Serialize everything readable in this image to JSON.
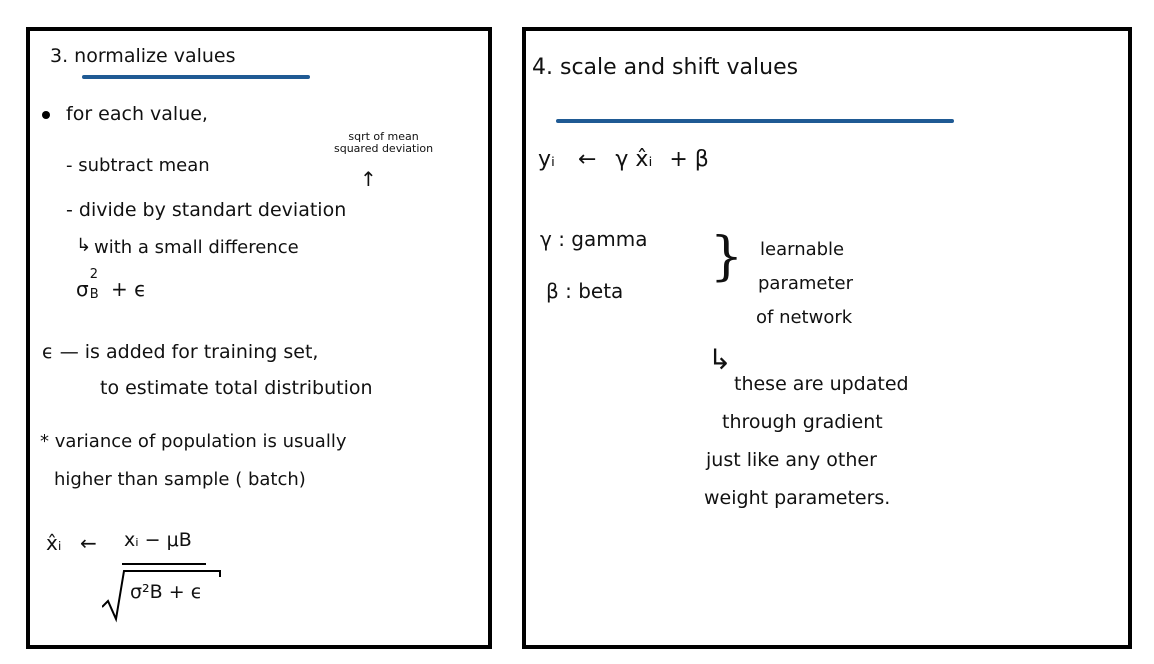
{
  "left": {
    "heading": "3. normalize values",
    "bullet": "for each value,",
    "step1": "- subtract mean",
    "note": "sqrt of mean\nsquared deviation",
    "note_line1": "sqrt of mean",
    "note_line2": "squared deviation",
    "note_arrow": "↑",
    "step2": "- divide by standart deviation",
    "sub_hook": "↳",
    "sub_text": "with a small difference",
    "var_expr": "σ²B + ϵ",
    "var_sigma": "σ",
    "var_sup": "2",
    "var_sub": "B",
    "var_rest": "+ ϵ",
    "eps_line1": "ϵ — is added for training set,",
    "eps_line2": "to estimate total distribution",
    "star_line1": "* variance of population is usually",
    "star_line2": "higher than sample ( batch)",
    "formula": {
      "lhs": "x̂ᵢ",
      "arrow": "←",
      "numerator": "xᵢ − μB",
      "denominator": "σ²B + ϵ"
    }
  },
  "right": {
    "heading": "4. scale and shift values",
    "eq_y": "yᵢ",
    "eq_arrow": "←",
    "eq_gamma": "γ",
    "eq_xhat": "x̂ᵢ",
    "eq_plus_beta": "+ β",
    "gamma_def": "γ : gamma",
    "beta_def": "β : beta",
    "brace": "}",
    "learn1": "learnable",
    "learn2": "parameter",
    "learn3": "of network",
    "hook": "↳",
    "upd1": "these are updated",
    "upd2": "through gradient",
    "upd3": "just like any other",
    "upd4": "weight parameters."
  }
}
